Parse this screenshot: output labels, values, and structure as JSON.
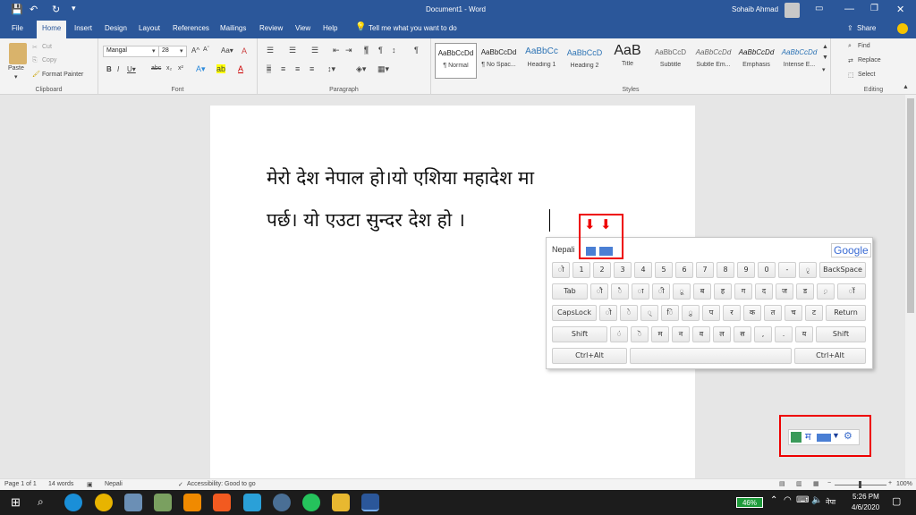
{
  "titlebar": {
    "doc_title": "Document1 - Word",
    "user": "Sohaib Ahmad"
  },
  "tabs": [
    "File",
    "Home",
    "Insert",
    "Design",
    "Layout",
    "References",
    "Mailings",
    "Review",
    "View",
    "Help"
  ],
  "tell_me": "Tell me what you want to do",
  "share": "Share",
  "clipboard": {
    "paste": "Paste",
    "cut": "Cut",
    "copy": "Copy",
    "format_painter": "Format Painter",
    "label": "Clipboard"
  },
  "font": {
    "name": "Mangal",
    "size": "28",
    "label": "Font"
  },
  "paragraph": {
    "label": "Paragraph"
  },
  "styles": {
    "label": "Styles",
    "items": [
      {
        "preview": "AaBbCcDd",
        "name": "¶ Normal"
      },
      {
        "preview": "AaBbCcDd",
        "name": "¶ No Spac..."
      },
      {
        "preview": "AaBbCc",
        "name": "Heading 1"
      },
      {
        "preview": "AaBbCcD",
        "name": "Heading 2"
      },
      {
        "preview": "AaB",
        "name": "Title"
      },
      {
        "preview": "AaBbCcD",
        "name": "Subtitle"
      },
      {
        "preview": "AaBbCcDd",
        "name": "Subtle Em..."
      },
      {
        "preview": "AaBbCcDd",
        "name": "Emphasis"
      },
      {
        "preview": "AaBbCcDd",
        "name": "Intense E..."
      }
    ]
  },
  "editing": {
    "find": "Find",
    "replace": "Replace",
    "select": "Select",
    "label": "Editing"
  },
  "document": {
    "line1": "मेरो देश नेपाल हो।यो एशिया महादेश मा",
    "line2": "पर्छ। यो एउटा सुन्दर देश हो ।"
  },
  "keyboard": {
    "title": "Nepali",
    "brand": "Google",
    "row1": [
      "ो",
      "1",
      "2",
      "3",
      "4",
      "5",
      "6",
      "7",
      "8",
      "9",
      "0",
      "-",
      "ृ",
      "BackSpace"
    ],
    "row2": [
      "Tab",
      "ौ",
      "ै",
      "ा",
      "ी",
      "ू",
      "ब",
      "ह",
      "ग",
      "द",
      "ज",
      "ड",
      "़",
      "ॉ"
    ],
    "row3": [
      "CapsLock",
      "ो",
      "े",
      "्",
      "ि",
      "ु",
      "प",
      "र",
      "क",
      "त",
      "च",
      "ट",
      "Return"
    ],
    "row4": [
      "Shift",
      "ं",
      "ॆ",
      "म",
      "न",
      "व",
      "ल",
      "स",
      ",",
      ".",
      "य",
      "Shift"
    ],
    "row5": [
      "Ctrl+Alt",
      "",
      "Ctrl+Alt"
    ]
  },
  "ime_bar": {
    "label": "म"
  },
  "status": {
    "page": "Page 1 of 1",
    "words": "14 words",
    "language": "Nepali",
    "accessibility": "Accessibility: Good to go",
    "zoom": "100%"
  },
  "taskbar": {
    "battery": "46%",
    "lang": "नेपा",
    "time": "5:26 PM",
    "date": "4/6/2020"
  }
}
